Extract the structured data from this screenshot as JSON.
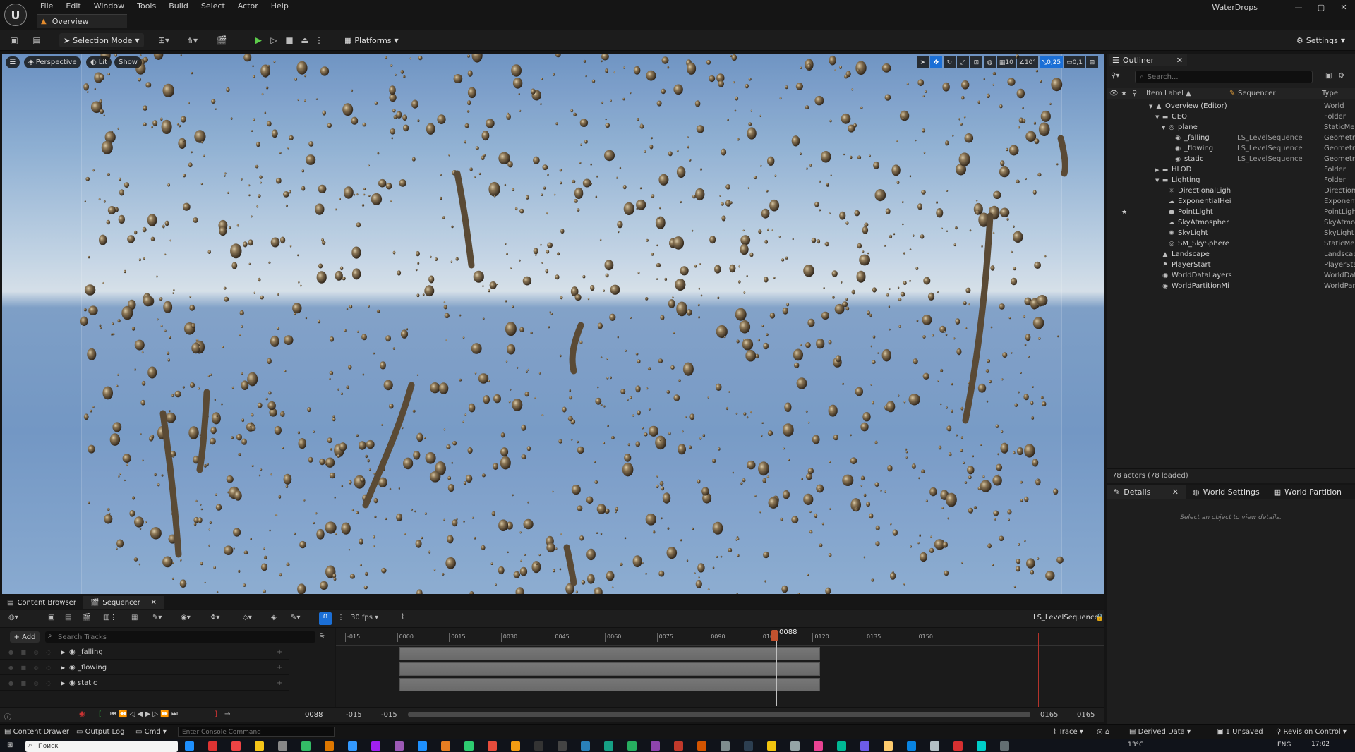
{
  "menu": [
    "File",
    "Edit",
    "Window",
    "Tools",
    "Build",
    "Select",
    "Actor",
    "Help"
  ],
  "doc_tab": "Overview",
  "app_title": "WaterDrops",
  "window_controls": [
    "—",
    "▢",
    "✕"
  ],
  "toolbar": {
    "selection_mode": "Selection Mode",
    "platforms": "Platforms",
    "settings": "Settings"
  },
  "viewport": {
    "perspective": "Perspective",
    "lit": "Lit",
    "show": "Show",
    "grid_snap": "10",
    "rot_snap": "10°",
    "scale_snap": "0,25",
    "cam_speed": "0,1"
  },
  "outliner": {
    "tab": "Outliner",
    "search_placeholder": "Search...",
    "col_label": "Item Label ▲",
    "col_seq": "Sequencer",
    "col_type": "Type",
    "rows": [
      {
        "indent": 0,
        "tri": "▼",
        "icon": "▲",
        "label": "Overview (Editor)",
        "seq": "",
        "type": "World"
      },
      {
        "indent": 1,
        "tri": "▼",
        "icon": "▬",
        "label": "GEO",
        "seq": "",
        "type": "Folder"
      },
      {
        "indent": 2,
        "tri": "▼",
        "icon": "◎",
        "label": "plane",
        "seq": "",
        "type": "StaticMe"
      },
      {
        "indent": 3,
        "tri": "",
        "icon": "◉",
        "label": "_falling",
        "seq": "LS_LevelSequence",
        "type": "Geometry"
      },
      {
        "indent": 3,
        "tri": "",
        "icon": "◉",
        "label": "_flowing",
        "seq": "LS_LevelSequence",
        "type": "Geometry"
      },
      {
        "indent": 3,
        "tri": "",
        "icon": "◉",
        "label": "static",
        "seq": "LS_LevelSequence",
        "type": "Geometry"
      },
      {
        "indent": 1,
        "tri": "▶",
        "icon": "▬",
        "label": "HLOD",
        "seq": "",
        "type": "Folder"
      },
      {
        "indent": 1,
        "tri": "▼",
        "icon": "▬",
        "label": "Lighting",
        "seq": "",
        "type": "Folder"
      },
      {
        "indent": 2,
        "tri": "",
        "icon": "✳",
        "label": "DirectionalLigh",
        "seq": "",
        "type": "Direction"
      },
      {
        "indent": 2,
        "tri": "",
        "icon": "☁",
        "label": "ExponentialHei",
        "seq": "",
        "type": "Exponent"
      },
      {
        "indent": 2,
        "tri": "",
        "icon": "●",
        "label": "PointLight",
        "seq": "",
        "type": "PointLigh",
        "star": true
      },
      {
        "indent": 2,
        "tri": "",
        "icon": "☁",
        "label": "SkyAtmospher",
        "seq": "",
        "type": "SkyAtmo"
      },
      {
        "indent": 2,
        "tri": "",
        "icon": "✺",
        "label": "SkyLight",
        "seq": "",
        "type": "SkyLight"
      },
      {
        "indent": 2,
        "tri": "",
        "icon": "◎",
        "label": "SM_SkySphere",
        "seq": "",
        "type": "StaticMe"
      },
      {
        "indent": 1,
        "tri": "",
        "icon": "▲",
        "label": "Landscape",
        "seq": "",
        "type": "Landscap"
      },
      {
        "indent": 1,
        "tri": "",
        "icon": "⚑",
        "label": "PlayerStart",
        "seq": "",
        "type": "PlayerSta"
      },
      {
        "indent": 1,
        "tri": "",
        "icon": "◉",
        "label": "WorldDataLayers",
        "seq": "",
        "type": "WorldDat"
      },
      {
        "indent": 1,
        "tri": "",
        "icon": "◉",
        "label": "WorldPartitionMi",
        "seq": "",
        "type": "WorldPar"
      }
    ],
    "footer": "78 actors (78 loaded)"
  },
  "details": {
    "tabs": [
      "Details",
      "World Settings",
      "World Partition"
    ],
    "empty": "Select an object to view details."
  },
  "sequencer": {
    "tabs": [
      "Content Browser",
      "Sequencer"
    ],
    "fps": "30 fps",
    "sequence_name": "LS_LevelSequence",
    "add": "+ Add",
    "search_placeholder": "Search Tracks",
    "tracks": [
      "_falling",
      "_flowing",
      "static"
    ],
    "ruler": [
      "-015",
      "0000",
      "0015",
      "0030",
      "0045",
      "0060",
      "0075",
      "0090",
      "0105",
      "0120",
      "0135",
      "0150"
    ],
    "current_frame": "0088",
    "range_start_a": "-015",
    "range_start_b": "-015",
    "range_end_a": "0165",
    "range_end_b": "0165"
  },
  "statusbar": {
    "content_drawer": "Content Drawer",
    "output_log": "Output Log",
    "cmd": "Cmd",
    "console_placeholder": "Enter Console Command",
    "trace": "Trace",
    "derived_data": "Derived Data",
    "unsaved": "1 Unsaved",
    "revision": "Revision Control"
  },
  "taskbar": {
    "search": "Поиск",
    "time": "17:02",
    "lang": "ENG",
    "temp": "13°C"
  },
  "colors": {
    "accent_blue": "#1b6fd6",
    "play_green": "#5ccc4a",
    "playhead": "#c1522f"
  }
}
